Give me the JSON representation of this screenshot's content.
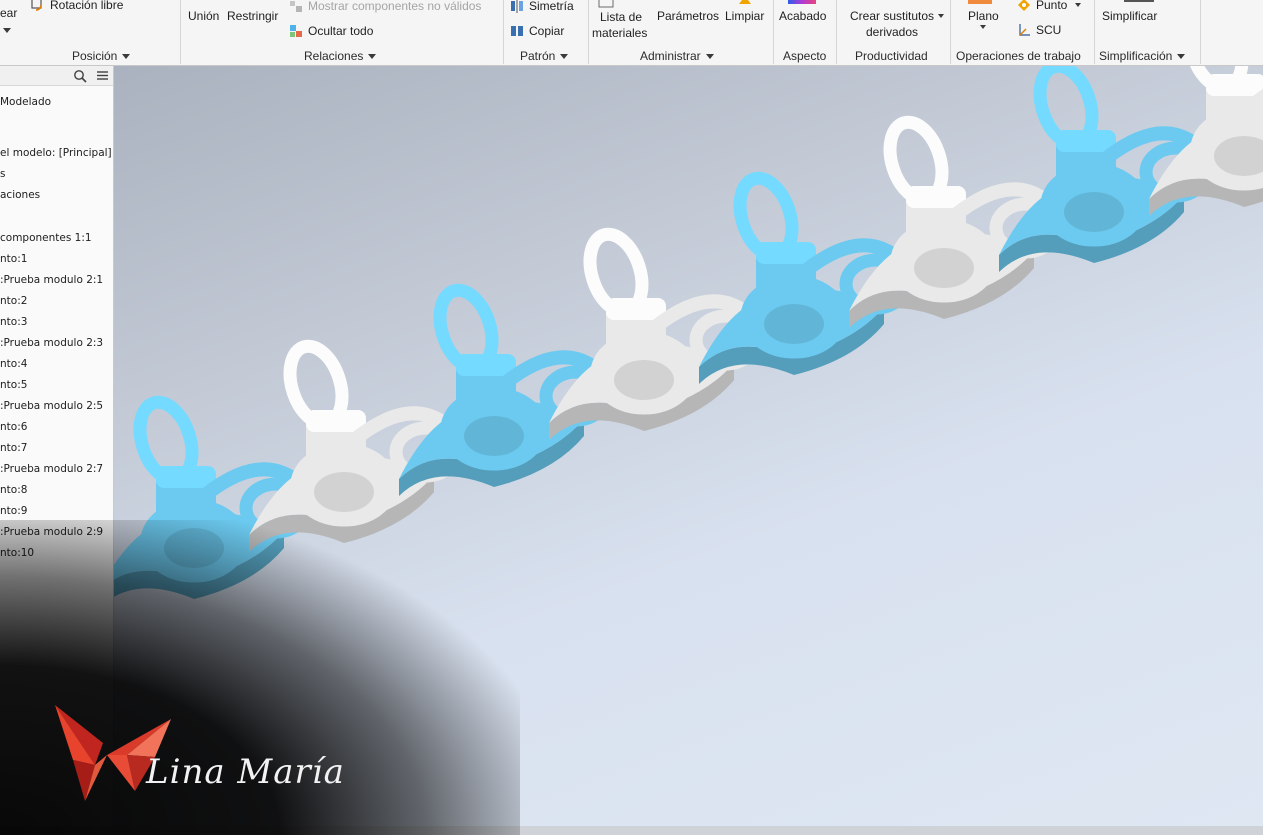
{
  "ribbon": {
    "buttons": {
      "crear": "ear",
      "rotacion_libre": "Rotación libre",
      "union": "Unión",
      "restringir": "Restringir",
      "mostrar_no_validos": "Mostrar componentes no válidos",
      "ocultar_todo": "Ocultar todo",
      "simetria": "Simetría",
      "copiar": "Copiar",
      "lista_materiales_1": "Lista de",
      "lista_materiales_2": "materiales",
      "parametros": "Parámetros",
      "limpiar": "Limpiar",
      "acabado": "Acabado",
      "crear_sustitutos_1": "Crear sustitutos",
      "crear_sustitutos_2": "derivados",
      "plano": "Plano",
      "punto": "Punto",
      "scu": "SCU",
      "simplificar": "Simplificar"
    },
    "panels": {
      "posicion": "Posición",
      "relaciones": "Relaciones",
      "patron": "Patrón",
      "administrar": "Administrar",
      "aspecto": "Aspecto",
      "productividad": "Productividad",
      "operaciones": "Operaciones de trabajo",
      "simplificacion": "Simplificación"
    }
  },
  "browser": {
    "items": [
      "Modelado",
      "el modelo: [Principal]",
      "s",
      "aciones",
      "componentes 1:1",
      "nto:1",
      ":Prueba modulo 2:1",
      "nto:2",
      "nto:3",
      ":Prueba modulo 2:3",
      "nto:4",
      "nto:5",
      ":Prueba modulo 2:5",
      "nto:6",
      "nto:7",
      ":Prueba modulo 2:7",
      "nto:8",
      "nto:9",
      ":Prueba modulo 2:9",
      "nto:10"
    ]
  },
  "viewport": {
    "colors": {
      "module_a": "#6ccaf0",
      "module_b": "#e9e9e9"
    }
  },
  "watermark": {
    "text": "Lina María"
  }
}
